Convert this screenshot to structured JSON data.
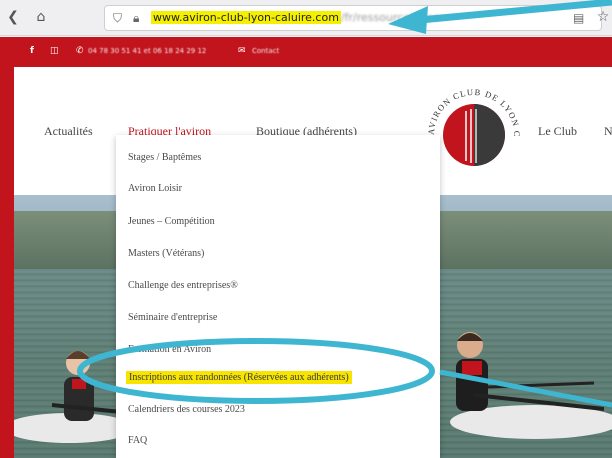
{
  "browser": {
    "url_highlight": "www.aviron-club-lyon-caluire.com",
    "url_rest": "/fr/ressources/doc",
    "icons": [
      "back-icon",
      "home-icon",
      "shield-icon",
      "lock-icon",
      "reader-icon",
      "star-icon"
    ]
  },
  "topbar": {
    "phones": "04 78 30 51 41 et 06 18 24 29 12",
    "contact": "Contact"
  },
  "nav": {
    "items": [
      {
        "label": "Actualités"
      },
      {
        "label": "Pratiquer l'aviron"
      },
      {
        "label": "Boutique (adhérents)"
      },
      {
        "label": "Le Club"
      },
      {
        "label": "N"
      }
    ]
  },
  "logo": {
    "ring_text": "AVIRON CLUB DE LYON CALUIRE"
  },
  "dropdown": {
    "items": [
      {
        "label": "Stages / Baptêmes"
      },
      {
        "label": "Aviron Loisir"
      },
      {
        "label": "Jeunes – Compétition"
      },
      {
        "label": "Masters (Vétérans)"
      },
      {
        "label": "Challenge des entreprises®"
      },
      {
        "label": "Séminaire d'entreprise"
      },
      {
        "label": "Formation en Aviron"
      },
      {
        "label": "Inscriptions aux randonnées (Réservées aux adhérents)"
      },
      {
        "label": "Calendriers des courses 2023"
      },
      {
        "label": "FAQ"
      }
    ]
  },
  "colors": {
    "brand_red": "#c2141d",
    "highlight_yellow": "#f7e500",
    "annotation_teal": "#3fb6d1"
  }
}
